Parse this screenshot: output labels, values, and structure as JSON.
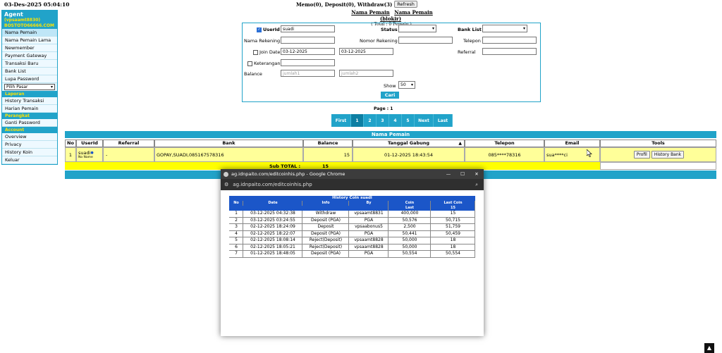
{
  "datetime": "03-Des-2025 05:04:10",
  "sidebar": {
    "agent": "Agent",
    "user": "(vpsaamt8830)",
    "site": "BOSTOTO66666.COM",
    "items": [
      "Nama Pemain",
      "Nama Pemain Lama",
      "Newmember",
      "Payment Gateway",
      "Transaksi Baru",
      "Bank List",
      "Lupa Password"
    ],
    "select": "Pilih Pasar",
    "laporan_title": "Laporan",
    "laporan_items": [
      "History Transaksi",
      "Harian Pemain"
    ],
    "perangkat_title": "Perangkat",
    "perangkat_items": [
      "Ganti Password"
    ],
    "account_title": "Account",
    "account_items": [
      "Overview",
      "Privacy",
      "History Koin",
      "Keluar"
    ]
  },
  "top": {
    "memo_text": "Memo(0), Deposit(0), Withdraw(3)",
    "refresh": "Refresh",
    "link1": "Nama Pemain",
    "link2": "Nama Pemain (blokir)",
    "total": "( Total : 0 Pemain )"
  },
  "form": {
    "userid_label": "UserId",
    "userid_value": "suadi",
    "status_label": "Status",
    "banklist_label": "Bank List",
    "nama_rekening": "Nama Rekening",
    "nomor_rekening": "Nomor Rekening",
    "telepon": "Telepon",
    "join_date": "Join Date",
    "date_from": "03-12-2025",
    "date_to": "03-12-2025",
    "referral": "Referral",
    "keterangan": "Keterangan",
    "balance": "Balance",
    "jumlah1": "jumlah1",
    "jumlah2": "jumlah2",
    "show_label": "Show",
    "show_value": "50",
    "cari": "Cari"
  },
  "pagination": {
    "page_text": "Page : 1",
    "first": "First",
    "pages": [
      "1",
      "2",
      "3",
      "4",
      "5"
    ],
    "next": "Next",
    "last": "Last"
  },
  "table": {
    "title": "Nama Pemain",
    "headers": [
      "No",
      "UserId",
      "Referral",
      "Bank",
      "Balance",
      "Tanggal Gabung",
      "Telepon",
      "Email",
      "Tools"
    ],
    "row": {
      "no": "1",
      "userid": "suadi",
      "subname": "No Name",
      "referral": "-",
      "bank": "GOPAY,SUADI,085167578316",
      "balance": "15",
      "tanggal": "01-12-2025 18:43:54",
      "telepon": "085****78316",
      "email": "sua****ci",
      "profil": "Profil",
      "history_bank": "History Bank"
    },
    "subtotal_label": "Sub TOTAL :",
    "subtotal_value": "15"
  },
  "popup": {
    "title": "ag.idnpaito.com/editcoinhis.php - Google Chrome",
    "url": "ag.idnpaito.com/editcoinhis.php",
    "table_title": "History Coin suadi",
    "headers": [
      "No",
      "Date",
      "Info",
      "By",
      "Coin",
      "Last Coin"
    ],
    "sub_headers": [
      "Last",
      "15"
    ],
    "rows": [
      [
        "1",
        "03-12-2025 04:32:38",
        "Withdraw",
        "vpsaamt8831",
        "400,000",
        "15"
      ],
      [
        "2",
        "03-12-2025 03:24:55",
        "Deposit (PGA)",
        "PGA",
        "50,576",
        "50,715"
      ],
      [
        "3",
        "02-12-2025 18:24:09",
        "Deposit",
        "vpsaabonus5",
        "2,500",
        "51,759"
      ],
      [
        "4",
        "02-12-2025 18:22:07",
        "Deposit (PGA)",
        "PGA",
        "50,441",
        "50,459"
      ],
      [
        "5",
        "02-12-2025 18:08:14",
        "Reject(Deposit)",
        "vpsaamt8828",
        "50,000",
        "18"
      ],
      [
        "6",
        "02-12-2025 18:05:21",
        "Reject(Deposit)",
        "vpsaamt8828",
        "50,000",
        "18"
      ],
      [
        "7",
        "01-12-2025 18:48:05",
        "Deposit (PGA)",
        "PGA",
        "50,554",
        "50,554"
      ]
    ]
  }
}
